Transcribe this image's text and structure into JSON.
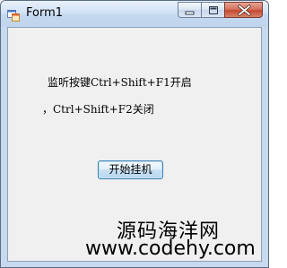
{
  "window": {
    "title": "Form1",
    "icon": "winforms-app-icon",
    "controls": {
      "minimize": "minimize-icon",
      "maximize": "maximize-icon",
      "close": "close-icon"
    }
  },
  "form": {
    "label_line1": "监听按键Ctrl+Shift+F1开启",
    "label_line2": "，Ctrl+Shift+F2关闭",
    "start_button_label": "开始挂机"
  },
  "watermark": {
    "line1": "源码海洋网",
    "line2": "www.codehy.com"
  },
  "colors": {
    "title_bar": "#c6d9ee",
    "client_bg": "#f0f0f0",
    "close_button": "#c44a31",
    "button_border": "#3c7fb1"
  }
}
